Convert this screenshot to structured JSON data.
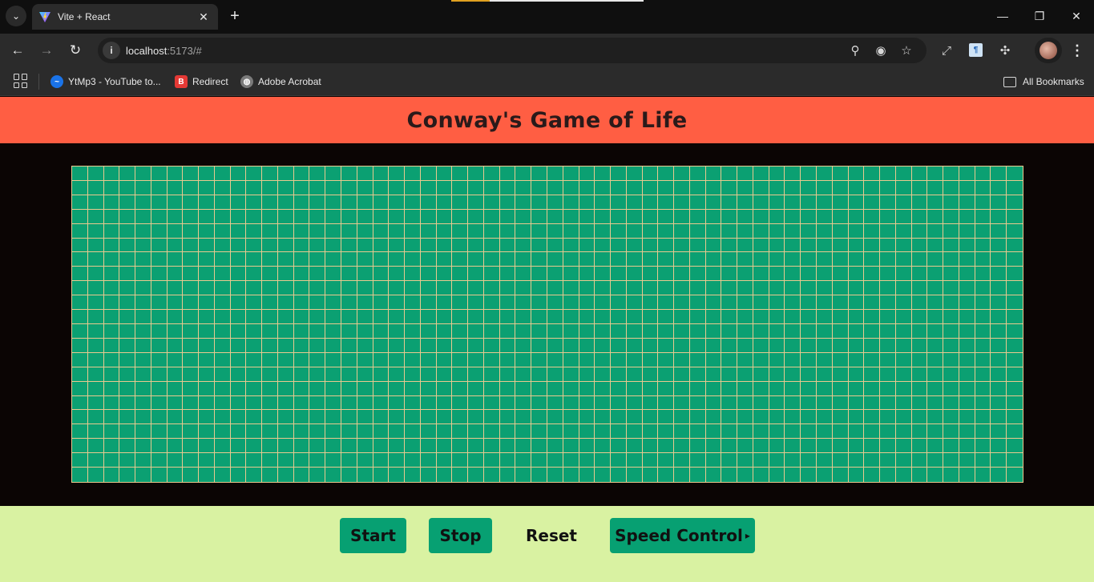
{
  "browser": {
    "tab_title": "Vite + React",
    "url_host": "localhost",
    "url_rest": ":5173/#",
    "bookmarks": [
      {
        "label": "YtMp3 - YouTube to...",
        "color": "#1a73e8"
      },
      {
        "label": "Redirect",
        "color": "#e53935"
      },
      {
        "label": "Adobe Acrobat",
        "color": "#7a7a7a"
      }
    ],
    "all_bookmarks_label": "All Bookmarks"
  },
  "app": {
    "title": "Conway's Game of Life",
    "grid": {
      "rows": 22,
      "cols": 60,
      "alive_cells": [],
      "cell_color": "#0ba072",
      "line_color": "#e9c98f"
    },
    "controls": {
      "start_label": "Start",
      "stop_label": "Stop",
      "reset_label": "Reset",
      "speed_label": "Speed Control",
      "speed_caret": "▸"
    }
  },
  "colors": {
    "header_bg": "#ff5e43",
    "board_bg": "#0b0504",
    "controls_bg": "#d9f2a2",
    "button_bg": "#07a072"
  }
}
